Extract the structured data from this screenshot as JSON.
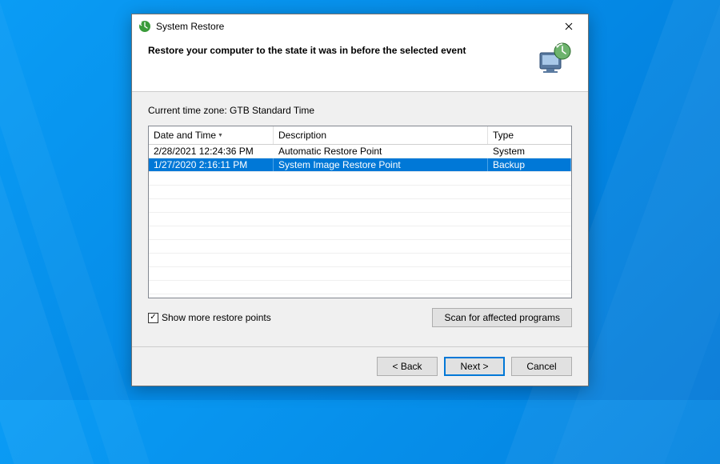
{
  "window": {
    "title": "System Restore",
    "heading": "Restore your computer to the state it was in before the selected event"
  },
  "timezone": "Current time zone: GTB Standard Time",
  "columns": {
    "date": "Date and Time",
    "desc": "Description",
    "type": "Type"
  },
  "rows": [
    {
      "date": "2/28/2021 12:24:36 PM",
      "desc": "Automatic Restore Point",
      "type": "System",
      "selected": false
    },
    {
      "date": "1/27/2020 2:16:11 PM",
      "desc": "System Image Restore Point",
      "type": "Backup",
      "selected": true
    }
  ],
  "checkbox": {
    "label": "Show more restore points",
    "checked": true
  },
  "buttons": {
    "scan": "Scan for affected programs",
    "back": "< Back",
    "next": "Next >",
    "cancel": "Cancel"
  }
}
